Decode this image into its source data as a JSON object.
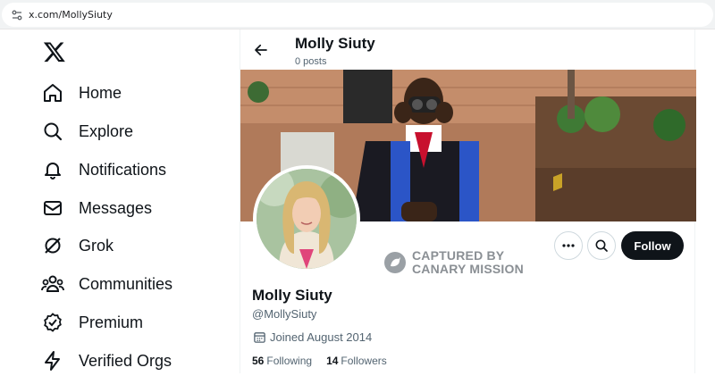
{
  "browser": {
    "url": "x.com/MollySiuty"
  },
  "sidebar": {
    "logo_icon": "x-logo-icon",
    "items": [
      {
        "label": "Home",
        "icon": "home-icon"
      },
      {
        "label": "Explore",
        "icon": "search-icon"
      },
      {
        "label": "Notifications",
        "icon": "bell-icon"
      },
      {
        "label": "Messages",
        "icon": "mail-icon"
      },
      {
        "label": "Grok",
        "icon": "grok-icon"
      },
      {
        "label": "Communities",
        "icon": "communities-icon"
      },
      {
        "label": "Premium",
        "icon": "premium-badge-icon"
      },
      {
        "label": "Verified Orgs",
        "icon": "lightning-icon"
      }
    ]
  },
  "header": {
    "name": "Molly Siuty",
    "posts": "0 posts"
  },
  "watermark": {
    "line1": "CAPTURED BY",
    "line2": "CANARY MISSION"
  },
  "profile": {
    "name": "Molly Siuty",
    "handle": "@MollySiuty",
    "joined": "Joined August 2014",
    "following_count": "56",
    "following_label": "Following",
    "followers_count": "14",
    "followers_label": "Followers",
    "follow_label": "Follow"
  },
  "colors": {
    "text": "#0f1419",
    "secondary": "#536471",
    "button": "#0f1419",
    "border": "#cfd9de"
  }
}
